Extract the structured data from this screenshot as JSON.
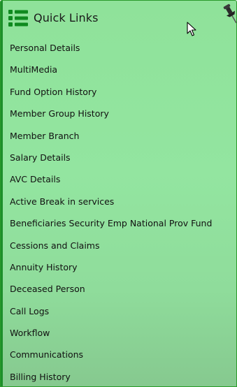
{
  "panel": {
    "title": "Quick Links",
    "header_icon": "list-icon",
    "corner_icon": "pushpin-icon",
    "accent_color": "#1d8f2a",
    "background_color": "#93e5a0"
  },
  "links": [
    {
      "label": "Personal Details"
    },
    {
      "label": "MultiMedia"
    },
    {
      "label": "Fund Option History"
    },
    {
      "label": "Member Group History"
    },
    {
      "label": "Member Branch"
    },
    {
      "label": "Salary Details"
    },
    {
      "label": "AVC Details"
    },
    {
      "label": "Active Break in services"
    },
    {
      "label": "Beneficiaries Security Emp National Prov Fund"
    },
    {
      "label": "Cessions and Claims"
    },
    {
      "label": "Annuity History"
    },
    {
      "label": "Deceased Person"
    },
    {
      "label": "Call Logs"
    },
    {
      "label": "Workflow"
    },
    {
      "label": "Communications"
    },
    {
      "label": "Billing History"
    }
  ]
}
